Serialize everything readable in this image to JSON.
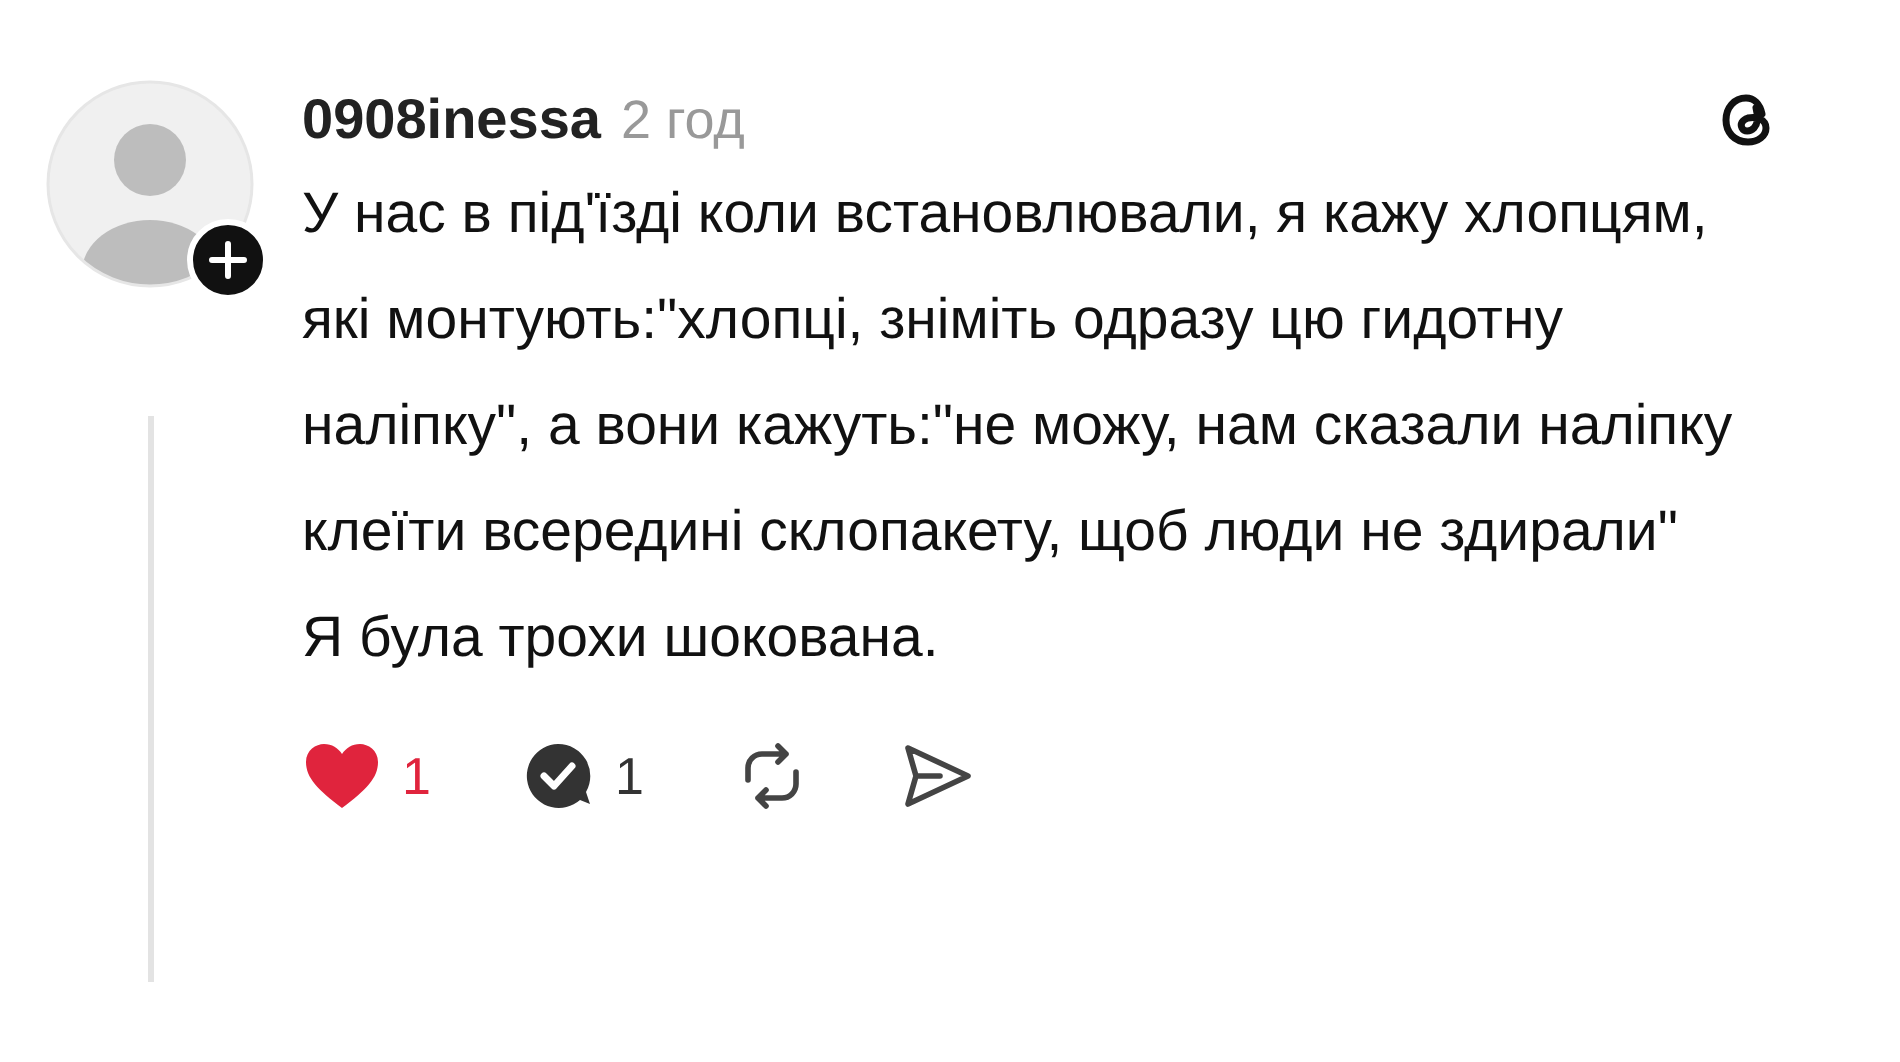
{
  "post": {
    "username": "0908inessa",
    "time": "2 год",
    "paragraphs": [
      "У нас в під'їзді коли встановлювали, я кажу хлопцям, які монтують:\"хлопці, зніміть одразу цю гидотну наліпку\", а вони кажуть:\"не можу, нам сказали наліпку клеїти всередині склопакету, щоб люди не здирали\"",
      "Я була трохи шокована."
    ],
    "likes": {
      "count": "1",
      "liked": true
    },
    "replies": {
      "count": "1"
    }
  }
}
